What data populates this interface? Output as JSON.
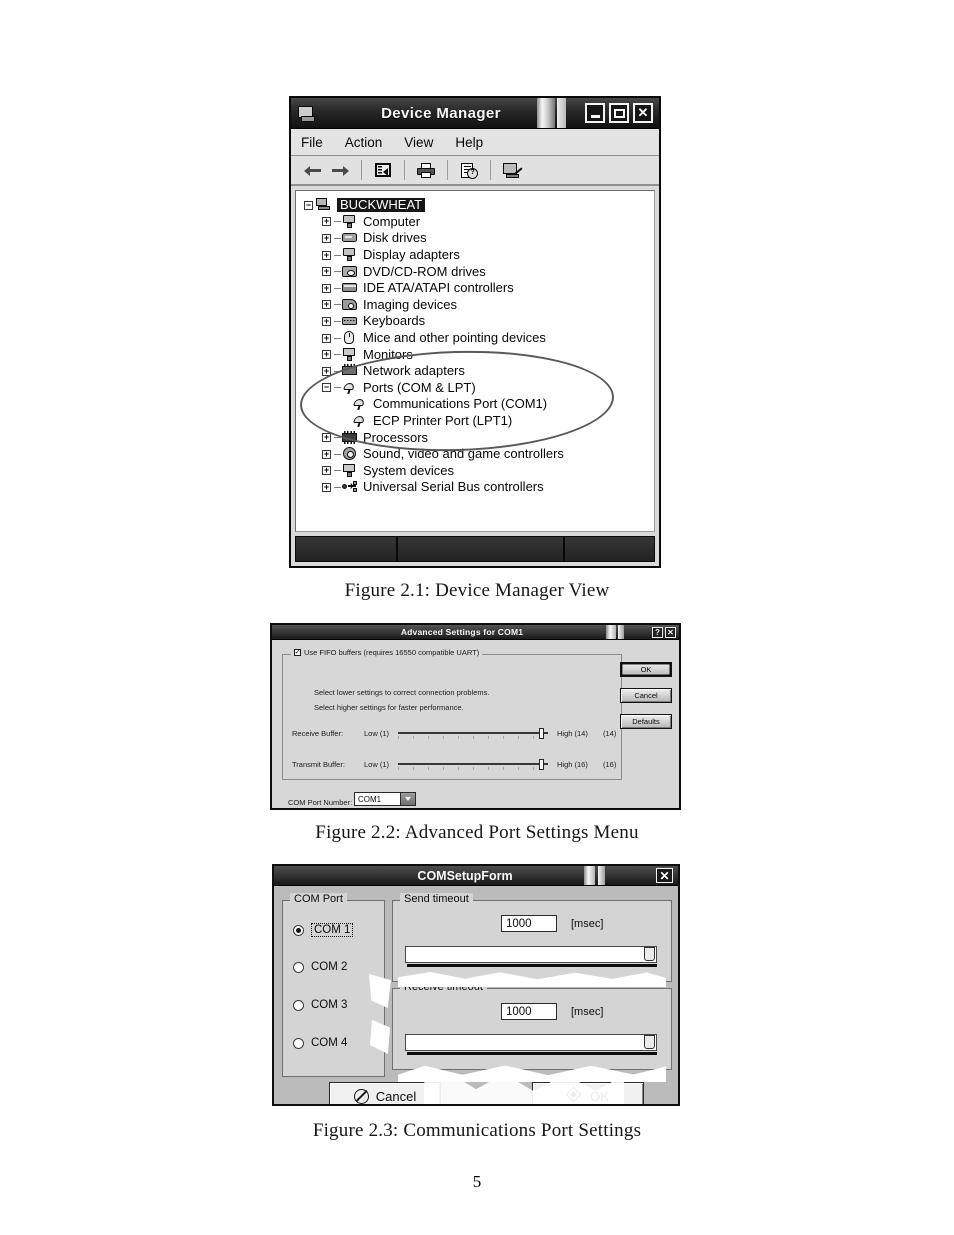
{
  "page": {
    "number": "5"
  },
  "figures": [
    {
      "id": "figure-2-1",
      "caption": "Figure 2.1: Device Manager View",
      "window": {
        "title": "Device Manager",
        "system_icon": "computer-icon",
        "buttons": {
          "minimize": "minimize-button",
          "maximize": "maximize-button",
          "close": "✕"
        },
        "menu": [
          "File",
          "Action",
          "View",
          "Help"
        ],
        "toolbar_icons": [
          "back-arrow-icon",
          "forward-arrow-icon",
          "properties-icon",
          "print-icon",
          "help-icon",
          "scan-for-hardware-changes-icon"
        ],
        "tree": {
          "root": {
            "label": "BUCKWHEAT",
            "icon": "computer-icon",
            "expander": "−",
            "selected": true
          },
          "children": [
            {
              "label": "Computer",
              "icon": "computer-icon",
              "expander": "+"
            },
            {
              "label": "Disk drives",
              "icon": "disk-drive-icon",
              "expander": "+"
            },
            {
              "label": "Display adapters",
              "icon": "display-adapter-icon",
              "expander": "+"
            },
            {
              "label": "DVD/CD-ROM drives",
              "icon": "dvd-drive-icon",
              "expander": "+"
            },
            {
              "label": "IDE ATA/ATAPI controllers",
              "icon": "ide-controller-icon",
              "expander": "+"
            },
            {
              "label": "Imaging devices",
              "icon": "imaging-device-icon",
              "expander": "+"
            },
            {
              "label": "Keyboards",
              "icon": "keyboard-icon",
              "expander": "+"
            },
            {
              "label": "Mice and other pointing devices",
              "icon": "mouse-icon",
              "expander": "+"
            },
            {
              "label": "Monitors",
              "icon": "monitor-icon",
              "expander": "+"
            },
            {
              "label": "Network adapters",
              "icon": "network-adapter-icon",
              "expander": "+"
            },
            {
              "label": "Ports (COM & LPT)",
              "icon": "port-icon",
              "expander": "−"
            },
            {
              "label": "Communications Port (COM1)",
              "icon": "port-icon",
              "expander": "",
              "level": 2
            },
            {
              "label": "ECP Printer Port (LPT1)",
              "icon": "port-icon",
              "expander": "",
              "level": 2
            },
            {
              "label": "Processors",
              "icon": "processor-icon",
              "expander": "+"
            },
            {
              "label": "Sound, video and game controllers",
              "icon": "sound-controller-icon",
              "expander": "+"
            },
            {
              "label": "System devices",
              "icon": "system-device-icon",
              "expander": "+"
            },
            {
              "label": "Universal Serial Bus controllers",
              "icon": "usb-controller-icon",
              "expander": "+"
            }
          ],
          "annotation": "hand-drawn ellipse around Ports (COM & LPT) branch"
        }
      }
    },
    {
      "id": "figure-2-2",
      "caption": "Figure 2.2: Advanced Port Settings Menu",
      "window": {
        "title": "Advanced Settings for COM1",
        "buttons": {
          "help": "?",
          "close": "✕"
        },
        "fifo": {
          "checked": true,
          "label": "Use FIFO buffers (requires 16550 compatible UART)"
        },
        "hints": [
          "Select lower settings to correct connection problems.",
          "Select higher settings for faster performance."
        ],
        "sliders": [
          {
            "label": "Receive Buffer:",
            "low": "Low (1)",
            "high": "High (14)",
            "value": "(14)"
          },
          {
            "label": "Transmit Buffer:",
            "low": "Low (1)",
            "high": "High (16)",
            "value": "(16)"
          }
        ],
        "com_port_number": {
          "label": "COM Port Number:",
          "value": "COM1"
        },
        "actions": [
          {
            "label": "OK",
            "primary": true
          },
          {
            "label": "Cancel",
            "primary": false
          },
          {
            "label": "Defaults",
            "primary": false
          }
        ]
      }
    },
    {
      "id": "figure-2-3",
      "caption": "Figure 2.3: Communications Port Settings",
      "window": {
        "title": "COMSetupForm",
        "buttons": {
          "close": "✕"
        },
        "com_port_group": {
          "title": "COM Port",
          "options": [
            {
              "label": "COM 1",
              "selected": true
            },
            {
              "label": "COM 2",
              "selected": false
            },
            {
              "label": "COM 3",
              "selected": false
            },
            {
              "label": "COM 4",
              "selected": false
            }
          ]
        },
        "send_timeout": {
          "title": "Send timeout",
          "value": "1000",
          "unit": "[msec]"
        },
        "receive_timeout": {
          "title": "Receive timeout",
          "value": "1000",
          "unit": "[msec]"
        },
        "actions": [
          {
            "label": "Cancel",
            "icon": "cancel-icon"
          },
          {
            "label": "OK",
            "icon": "ok-diamond-icon"
          }
        ]
      }
    }
  ]
}
